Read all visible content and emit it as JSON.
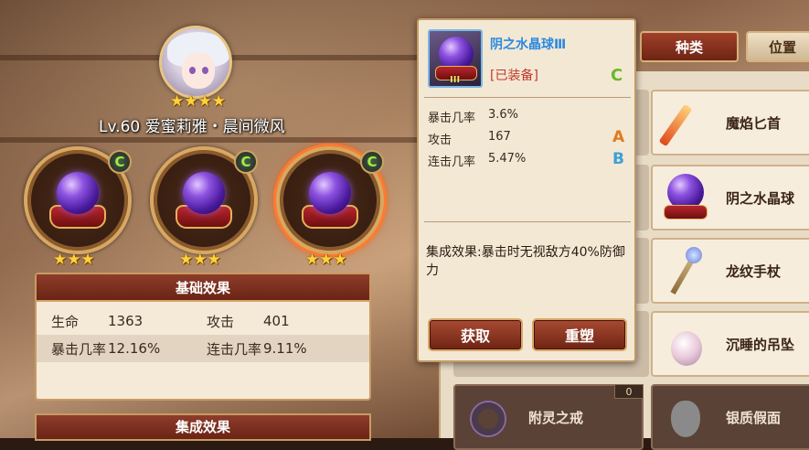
{
  "character": {
    "name": "Lv.60 爱蜜莉雅・晨间微风",
    "stars": "★★★★"
  },
  "slots": [
    {
      "grade": "C",
      "stars": "★★★"
    },
    {
      "grade": "C",
      "stars": "★★★"
    },
    {
      "grade": "C",
      "stars": "★★★"
    }
  ],
  "basic_effects": {
    "title": "基础效果",
    "rows": [
      [
        {
          "label": "生命",
          "value": "1363"
        },
        {
          "label": "攻击",
          "value": "401"
        }
      ],
      [
        {
          "label": "暴击几率",
          "value": "12.16%"
        },
        {
          "label": "连击几率",
          "value": "9.11%"
        }
      ]
    ]
  },
  "set_effects": {
    "title": "集成效果"
  },
  "tabs": {
    "type": "种类",
    "position": "位置"
  },
  "list_items": [
    {
      "name": "魔焰匕首",
      "icon": "dagger-icon"
    },
    {
      "name": "阴之水晶球",
      "icon": "crystal-orb-icon"
    },
    {
      "name": "龙纹手杖",
      "icon": "staff-icon"
    },
    {
      "name": "沉睡的吊坠",
      "icon": "pendant-icon"
    },
    {
      "name": "附灵之戒",
      "icon": "ring-icon"
    },
    {
      "name": "银质假面",
      "icon": "mask-icon"
    }
  ],
  "count_badge": "0",
  "popup": {
    "title": "阴之水晶球Ⅲ",
    "tier": "III",
    "equipped": "[已装备]",
    "grade": "C",
    "stats": [
      {
        "label": "暴击几率",
        "value": "3.6%",
        "grade": ""
      },
      {
        "label": "攻击",
        "value": "167",
        "grade": "A"
      },
      {
        "label": "连击几率",
        "value": "5.47%",
        "grade": "B"
      }
    ],
    "description": "集成效果:暴击时无视敌方40%防御力",
    "buttons": {
      "obtain": "获取",
      "reforge": "重塑"
    }
  },
  "colors": {
    "grade_c": "#6ab82a",
    "grade_a": "#e07a1e",
    "grade_b": "#3aa0d8"
  }
}
